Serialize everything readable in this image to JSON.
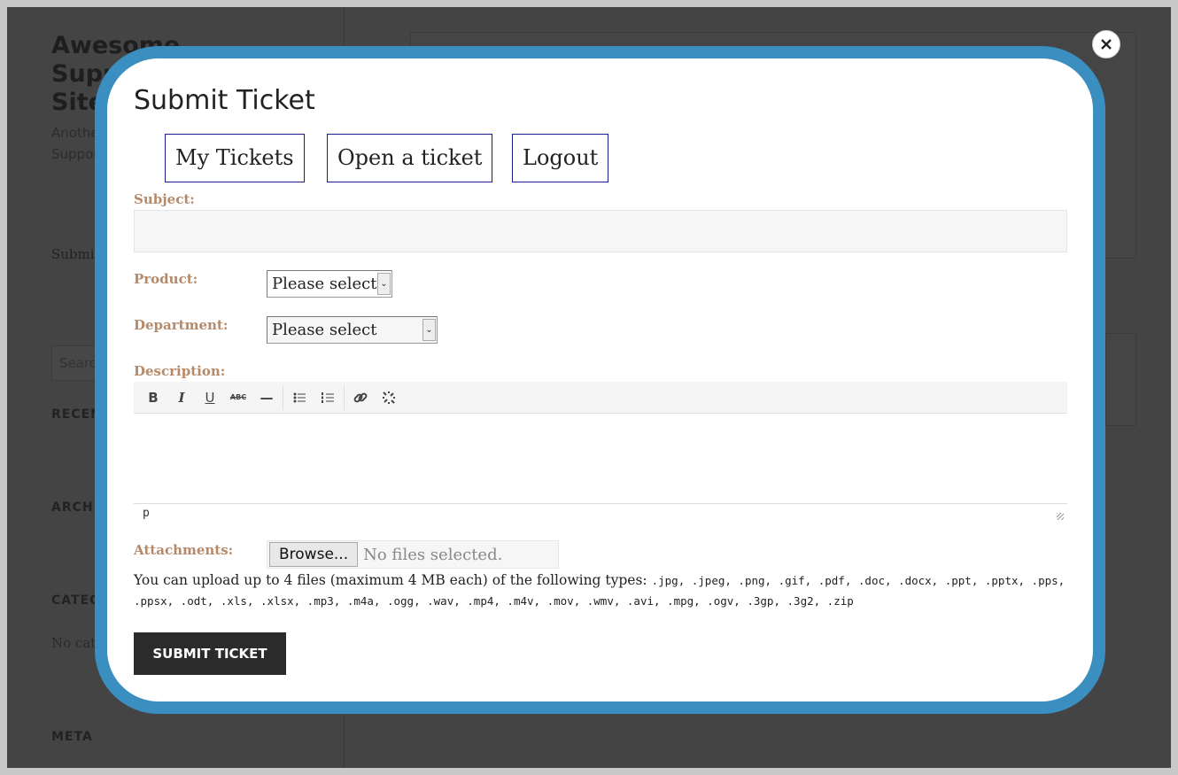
{
  "background": {
    "site_title": "Awesome Support Site",
    "site_desc": "Another Support",
    "submit_text": "Submi",
    "search_placeholder": "Searc",
    "recent": "RECEN",
    "archives": "ARCHI",
    "categories": "CATEG",
    "no_categories": "No cat",
    "meta": "META"
  },
  "modal": {
    "title": "Submit Ticket",
    "nav": [
      "My Tickets",
      "Open a ticket",
      "Logout"
    ],
    "subject_label": "Subject:",
    "product_label": "Product:",
    "product_value": "Please select",
    "department_label": "Department:",
    "department_value": "Please select",
    "description_label": "Description:",
    "toolbar": {
      "bold": "B",
      "italic": "I",
      "underline": "U",
      "strike": "ABC",
      "hr": "—"
    },
    "status_path": "p",
    "attachments_label": "Attachments:",
    "browse": "Browse...",
    "no_files": "No files selected.",
    "help_text": "You can upload up to 4 files (maximum 4 MB each) of the following types: ",
    "file_types": ".jpg, .jpeg, .png, .gif, .pdf, .doc, .docx, .ppt, .pptx, .pps, .ppsx, .odt, .xls, .xlsx, .mp3, .m4a, .ogg, .wav, .mp4, .m4v, .mov, .wmv, .avi, .mpg, .ogv, .3gp, .3g2, .zip",
    "submit": "SUBMIT TICKET"
  },
  "colors": {
    "accent": "#3a8fc0",
    "label": "#b58a6a"
  }
}
